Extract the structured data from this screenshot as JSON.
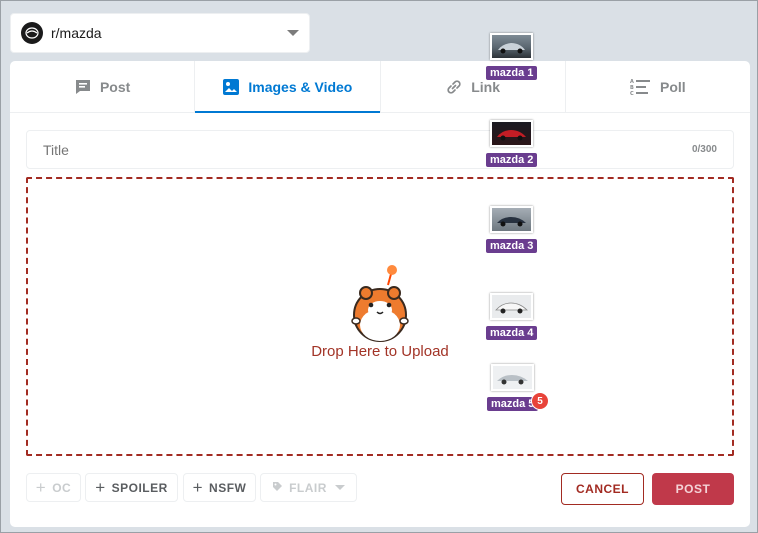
{
  "community": {
    "name": "r/mazda"
  },
  "tabs": [
    {
      "label": "Post",
      "icon": "post-icon"
    },
    {
      "label": "Images & Video",
      "icon": "image-icon",
      "active": true
    },
    {
      "label": "Link",
      "icon": "link-icon"
    },
    {
      "label": "Poll",
      "icon": "poll-icon"
    }
  ],
  "title_field": {
    "placeholder": "Title",
    "counter": "0/300"
  },
  "dropzone": {
    "text": "Drop Here to Upload"
  },
  "tags": {
    "oc": "OC",
    "spoiler": "SPOILER",
    "nsfw": "NSFW",
    "flair": "FLAIR"
  },
  "actions": {
    "cancel": "CANCEL",
    "post": "POST"
  },
  "drag_files": [
    {
      "label": "mazda 1"
    },
    {
      "label": "mazda 2"
    },
    {
      "label": "mazda 3"
    },
    {
      "label": "mazda 4"
    },
    {
      "label": "mazda 5"
    }
  ],
  "drag_count": "5",
  "colors": {
    "accent": "#0079d3",
    "danger": "#a22b22",
    "post": "#c0394a",
    "file_label": "#6a3d8f",
    "badge": "#e8433a"
  }
}
